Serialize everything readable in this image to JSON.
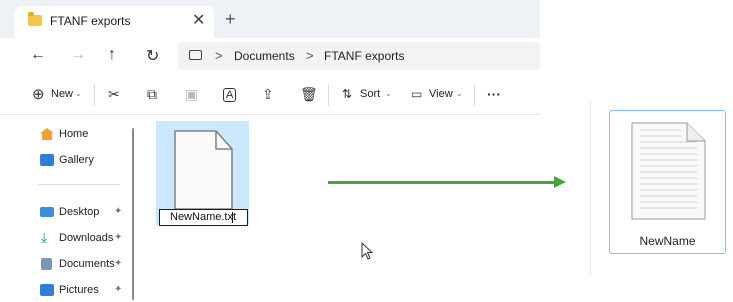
{
  "tab": {
    "title": "FTANF exports",
    "close_glyph": "✕",
    "new_tab_glyph": "+"
  },
  "nav": {
    "back": "←",
    "forward": "→",
    "up": "↑",
    "refresh": "↻"
  },
  "breadcrumb": {
    "separator": ">",
    "items": [
      "Documents",
      "FTANF exports"
    ]
  },
  "toolbar": {
    "new_label": "New",
    "sort_label": "Sort",
    "view_label": "View",
    "caret": "⌄",
    "more": "···"
  },
  "sidebar": {
    "items": [
      {
        "label": "Home",
        "icon": "home-icon",
        "color": "#f0a030"
      },
      {
        "label": "Gallery",
        "icon": "gallery-icon",
        "color": "#2f7fd6"
      },
      {
        "label": "Desktop",
        "icon": "desktop-icon",
        "color": "#3a8fd8",
        "pinned": true
      },
      {
        "label": "Downloads",
        "icon": "download-icon",
        "color": "#2a9a4a",
        "pinned": true
      },
      {
        "label": "Documents",
        "icon": "documents-icon",
        "color": "#7a95b8",
        "pinned": true
      },
      {
        "label": "Pictures",
        "icon": "pictures-icon",
        "color": "#2f7fd6",
        "pinned": true
      }
    ],
    "pin_glyph": "✦"
  },
  "file": {
    "rename_value": "NewName.txt",
    "selection_color": "#cce8ff"
  },
  "result": {
    "label": "NewName"
  },
  "colors": {
    "arrow": "#4aa53a",
    "selection_border": "#88bff0"
  }
}
